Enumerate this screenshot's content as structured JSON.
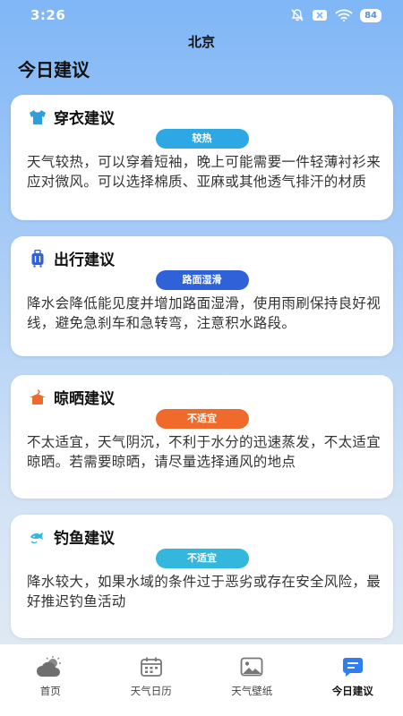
{
  "status_bar": {
    "time": "3:26",
    "battery": "84"
  },
  "header": {
    "city": "北京",
    "title": "今日建议"
  },
  "cards": [
    {
      "title": "穿衣建议",
      "icon": "shirt-icon",
      "badge": "较热",
      "badge_color": "#2ea8e5",
      "text": "天气较热，可以穿着短袖，晚上可能需要一件轻薄衬衫来应对微风。可以选择棉质、亚麻或其他透气排汗的材质"
    },
    {
      "title": "出行建议",
      "icon": "luggage-icon",
      "badge": "路面湿滑",
      "badge_color": "#2f62d8",
      "text": "降水会降低能见度并增加路面湿滑，使用雨刷保持良好视线，避免急刹车和急转弯，注意积水路段。"
    },
    {
      "title": "晾晒建议",
      "icon": "clothes-hanger-icon",
      "badge": "不适宜",
      "badge_color": "#f06a2b",
      "text": "不太适宜，天气阴沉，不利于水分的迅速蒸发，不太适宜晾晒。若需要晾晒，请尽量选择通风的地点"
    },
    {
      "title": "钓鱼建议",
      "icon": "fishing-icon",
      "badge": "不适宜",
      "badge_color": "#33b7dc",
      "text": "降水较大，如果水域的条件过于恶劣或存在安全风险，最好推迟钓鱼活动"
    }
  ],
  "bottom_nav": [
    {
      "label": "首页",
      "icon": "weather-cloud-icon"
    },
    {
      "label": "天气日历",
      "icon": "calendar-icon"
    },
    {
      "label": "天气壁纸",
      "icon": "image-icon"
    },
    {
      "label": "今日建议",
      "icon": "chat-icon",
      "active": true
    }
  ]
}
